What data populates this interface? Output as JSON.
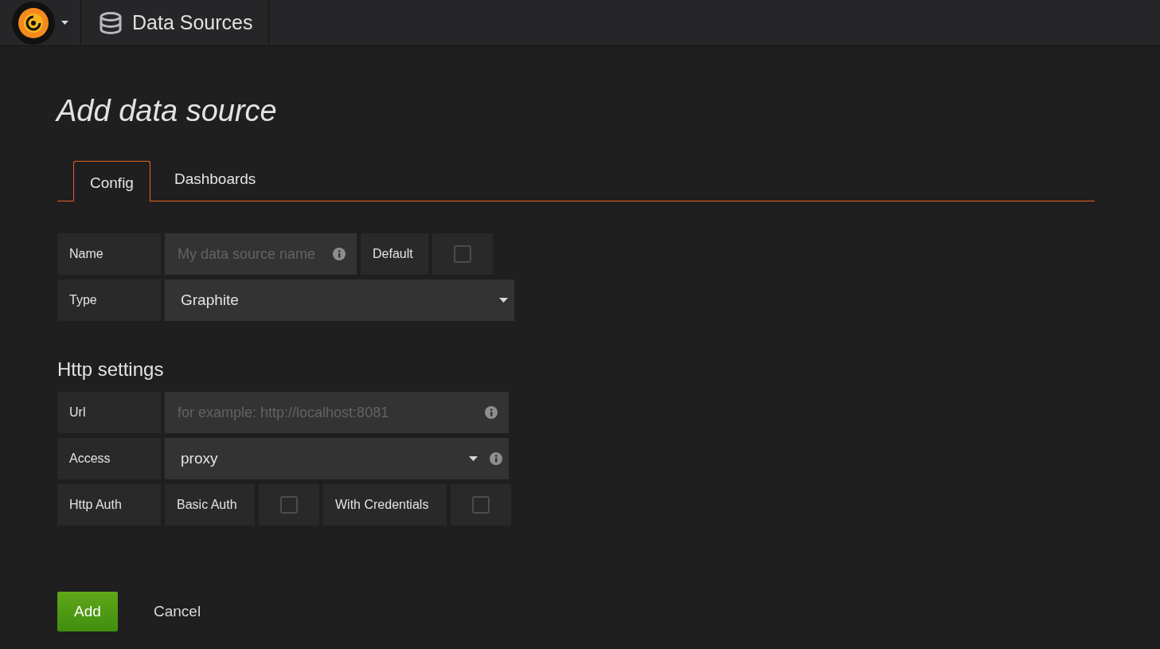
{
  "header": {
    "breadcrumb": "Data Sources"
  },
  "page_title": "Add data source",
  "tabs": [
    {
      "label": "Config",
      "selected": true
    },
    {
      "label": "Dashboards",
      "selected": false
    }
  ],
  "basic": {
    "name": {
      "label": "Name",
      "placeholder": "My data source name"
    },
    "default": {
      "label": "Default",
      "checked": false
    },
    "type": {
      "label": "Type",
      "value": "Graphite"
    }
  },
  "http_settings": {
    "heading": "Http settings",
    "url": {
      "label": "Url",
      "placeholder": "for example: http://localhost:8081"
    },
    "access": {
      "label": "Access",
      "value": "proxy"
    },
    "http_auth": {
      "label": "Http Auth",
      "options": [
        {
          "label": "Basic Auth",
          "checked": false
        },
        {
          "label": "With Credentials",
          "checked": false
        }
      ]
    }
  },
  "actions": {
    "add": "Add",
    "cancel": "Cancel"
  }
}
